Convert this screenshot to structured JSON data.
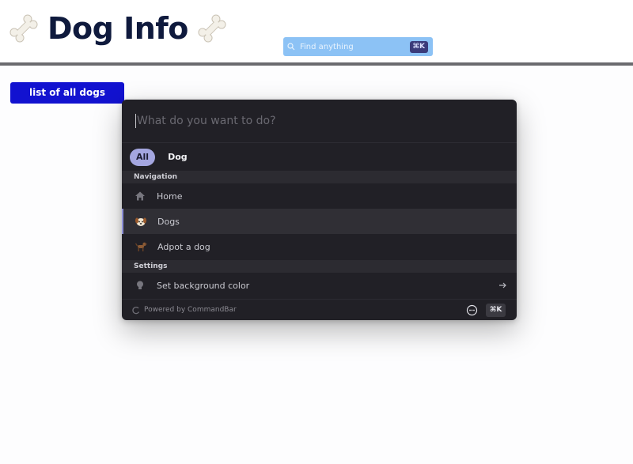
{
  "header": {
    "title": "Dog Info",
    "left_icon": "bone-icon",
    "right_icon": "bone-icon"
  },
  "search": {
    "placeholder": "Find anything",
    "shortcut": "⌘K",
    "icon": "search-icon"
  },
  "buttons": {
    "list_all": "list of all dogs"
  },
  "palette": {
    "input_placeholder": "What do you want to do?",
    "tabs": [
      {
        "label": "All",
        "active": true
      },
      {
        "label": "Dog",
        "active": false
      }
    ],
    "sections": [
      {
        "title": "Navigation",
        "items": [
          {
            "label": "Home",
            "icon": "home-icon"
          },
          {
            "label": "Dogs",
            "icon": "dog-face-icon",
            "selected": true
          },
          {
            "label": "Adpot a dog",
            "icon": "dog-icon"
          }
        ]
      },
      {
        "title": "Settings",
        "items": [
          {
            "label": "Set background color",
            "icon": "lightbulb-icon",
            "trailing_icon": "arrow-right-icon"
          }
        ]
      }
    ],
    "footer": {
      "powered_by": "Powered by CommandBar",
      "shortcut": "⌘K"
    }
  },
  "colors": {
    "brand_button": "#1212d0",
    "search_bg": "#8cc2f5",
    "palette_bg": "#212026",
    "tab_active": "#a4a6e0",
    "title_color": "#0f1a3d"
  }
}
